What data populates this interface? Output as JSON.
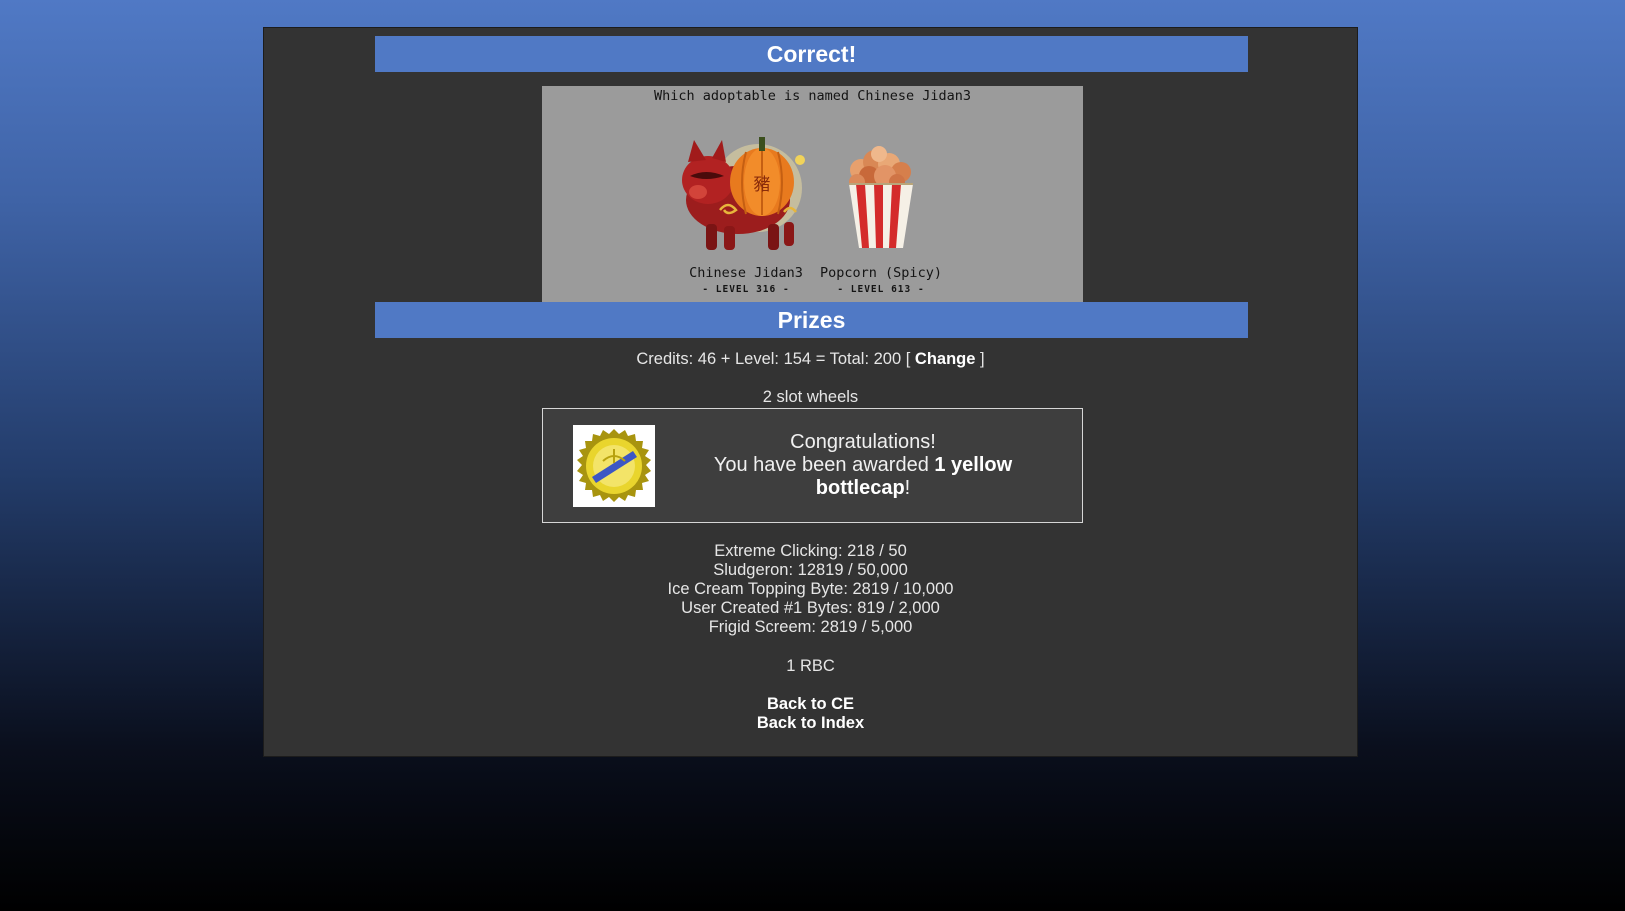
{
  "header": {
    "result_title": "Correct!"
  },
  "question": {
    "text": "Which adoptable is named Chinese Jidan3",
    "choices": [
      {
        "name": "Chinese Jidan3",
        "level": "- LEVEL 316 -",
        "icon": "pumpkin-pig-icon"
      },
      {
        "name": "Popcorn (Spicy)",
        "level": "- LEVEL 613 -",
        "icon": "popcorn-icon"
      }
    ]
  },
  "prizes": {
    "title": "Prizes",
    "credits_prefix": "Credits: 46 + Level: 154 = Total: 200 [ ",
    "change_label": "Change",
    "credits_suffix": " ]",
    "slot_wheels": "2 slot wheels",
    "award": {
      "icon": "yellow-bottlecap-icon",
      "line1": "Congratulations!",
      "line2_prefix": "You have been awarded ",
      "item": "1 yellow bottlecap",
      "line2_suffix": "!"
    },
    "skills": [
      "Extreme Clicking: 218 / 50",
      "Sludgeron: 12819 / 50,000",
      "Ice Cream Topping Byte: 2819 / 10,000",
      "User Created #1 Bytes: 819 / 2,000",
      "Frigid Screem: 2819 / 5,000"
    ],
    "rbc": "1 RBC"
  },
  "links": {
    "back_ce": "Back to CE",
    "back_index": "Back to Index"
  },
  "colors": {
    "header_bg": "#5079c5",
    "panel_bg": "#333333",
    "image_bg": "#9b9b9b"
  }
}
